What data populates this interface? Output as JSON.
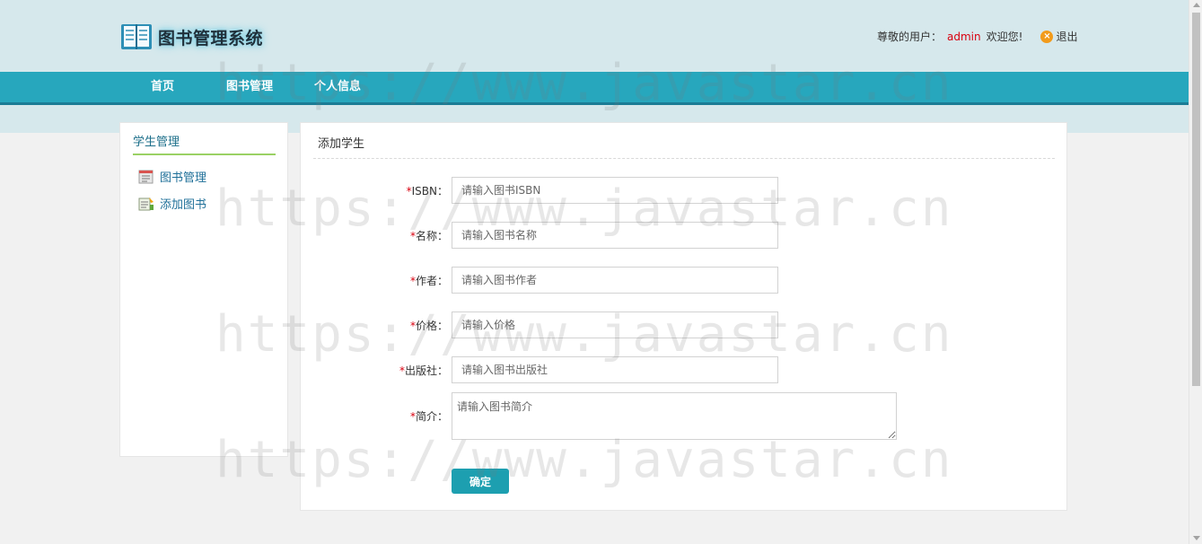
{
  "header": {
    "app_title": "图书管理系统",
    "greeting_prefix": "尊敬的用户：",
    "username": "admin",
    "greeting_suffix": "欢迎您!",
    "logout_label": "退出",
    "logo_icon": "open-book-icon",
    "logout_icon": "close-circle-icon"
  },
  "nav": {
    "items": [
      {
        "label": "首页"
      },
      {
        "label": "图书管理"
      },
      {
        "label": "个人信息"
      }
    ]
  },
  "sidebar": {
    "title": "学生管理",
    "items": [
      {
        "label": "图书管理",
        "icon": "book-list-icon"
      },
      {
        "label": "添加图书",
        "icon": "add-book-icon"
      }
    ]
  },
  "main": {
    "title": "添加学生",
    "fields": [
      {
        "label": "ISBN：",
        "placeholder": "请输入图书ISBN",
        "value": ""
      },
      {
        "label": "名称：",
        "placeholder": "请输入图书名称",
        "value": ""
      },
      {
        "label": "作者：",
        "placeholder": "请输入图书作者",
        "value": ""
      },
      {
        "label": "价格：",
        "placeholder": "请输入价格",
        "value": ""
      },
      {
        "label": "出版社：",
        "placeholder": "请输入图书出版社",
        "value": ""
      }
    ],
    "description": {
      "label": "简介：",
      "placeholder": "请输入图书简介",
      "value": ""
    },
    "required_mark": "*",
    "submit_label": "确定"
  },
  "watermark": "https://www.javastar.cn",
  "colors": {
    "header_bg": "#d6e8ec",
    "nav_bg": "#27a7bd",
    "accent_user": "#d9000f",
    "button_bg": "#1d9fb0",
    "sidebar_underline": "#9ad164"
  }
}
